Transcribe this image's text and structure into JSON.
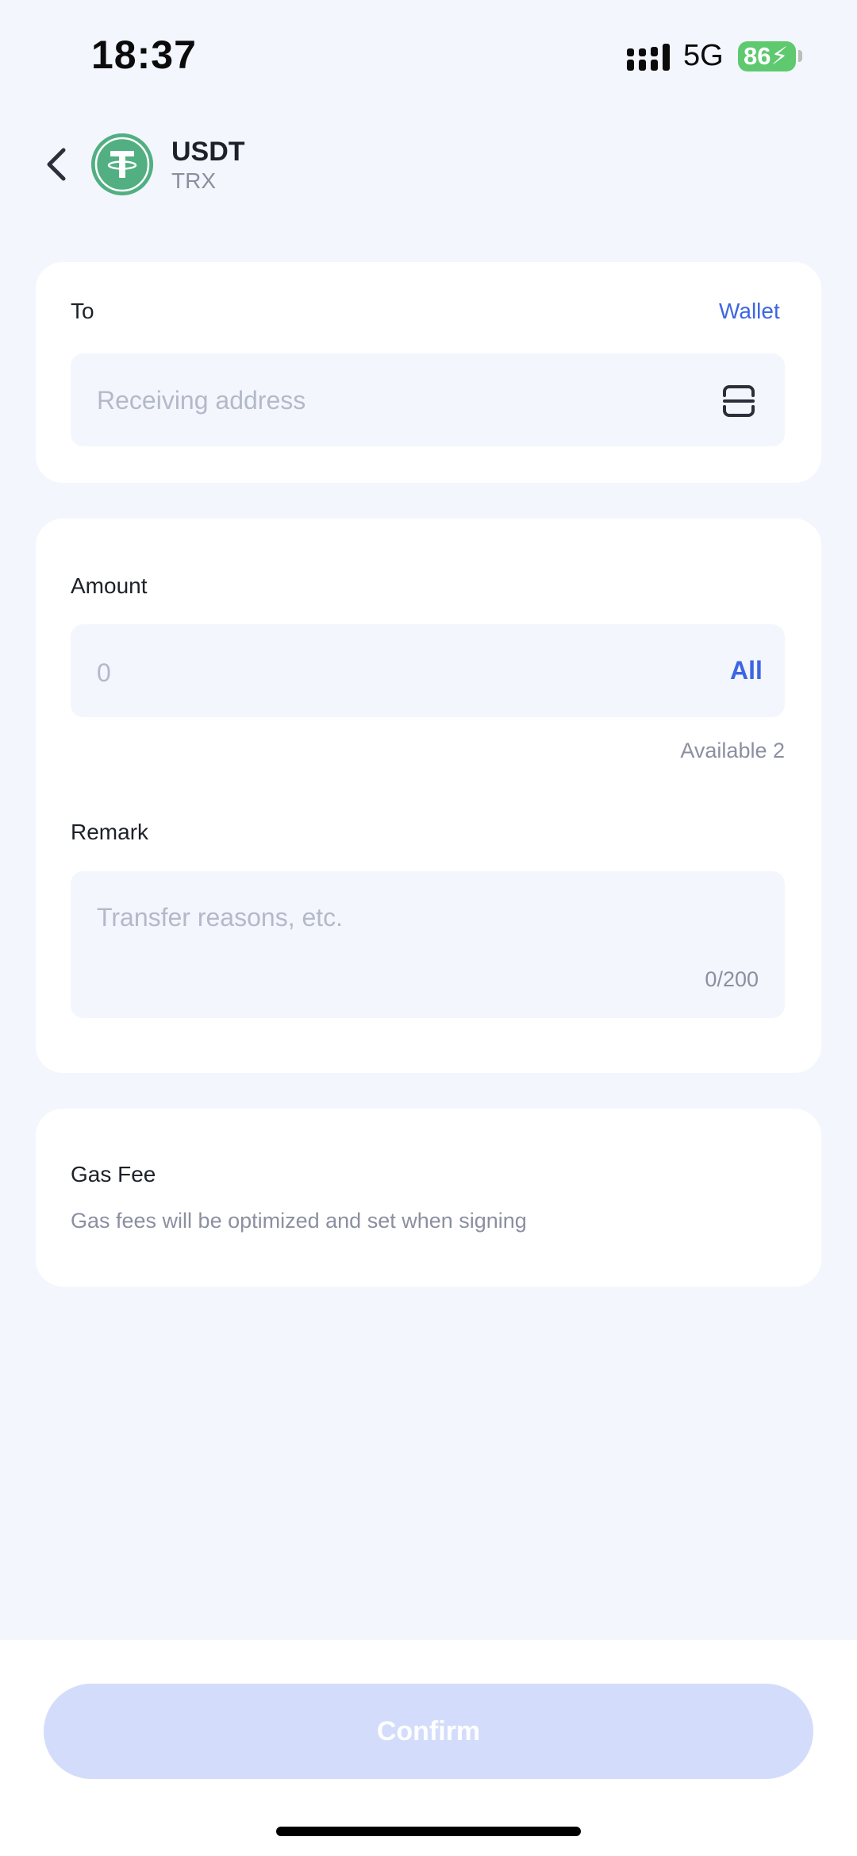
{
  "status_bar": {
    "time": "18:37",
    "network": "5G",
    "battery": "86"
  },
  "header": {
    "token": "USDT",
    "chain": "TRX"
  },
  "to_section": {
    "label": "To",
    "wallet_link": "Wallet",
    "address_placeholder": "Receiving address"
  },
  "amount_section": {
    "label": "Amount",
    "placeholder": "0",
    "all_label": "All",
    "available": "Available 2"
  },
  "remark_section": {
    "label": "Remark",
    "placeholder": "Transfer reasons, etc.",
    "counter": "0/200"
  },
  "gas_section": {
    "label": "Gas Fee",
    "note": "Gas fees will be optimized and set when signing"
  },
  "confirm_label": "Confirm",
  "colors": {
    "accent": "#3d66e3",
    "background": "#f3f6fd",
    "confirm_disabled": "#d3ddfb",
    "token_green": "#51af82",
    "battery_green": "#5ec96f"
  }
}
